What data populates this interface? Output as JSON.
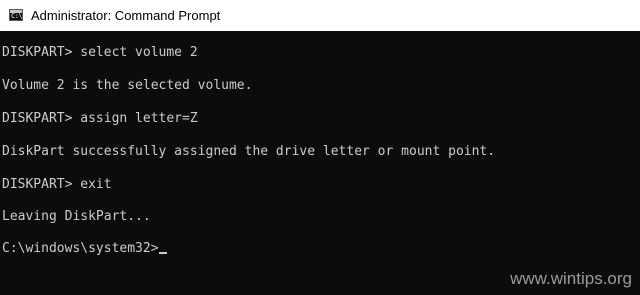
{
  "window": {
    "title": "Administrator: Command Prompt",
    "icon": "cmd-icon",
    "icon_text": "C:\\."
  },
  "console": {
    "lines": [
      "DISKPART> select volume 2",
      "Volume 2 is the selected volume.",
      "DISKPART> assign letter=Z",
      "DiskPart successfully assigned the drive letter or mount point.",
      "DISKPART> exit",
      "Leaving DiskPart...",
      "C:\\windows\\system32>"
    ],
    "text_color": "#cccccc",
    "background_color": "#0c0c0c"
  },
  "watermark": {
    "text": "www.wintips.org"
  }
}
